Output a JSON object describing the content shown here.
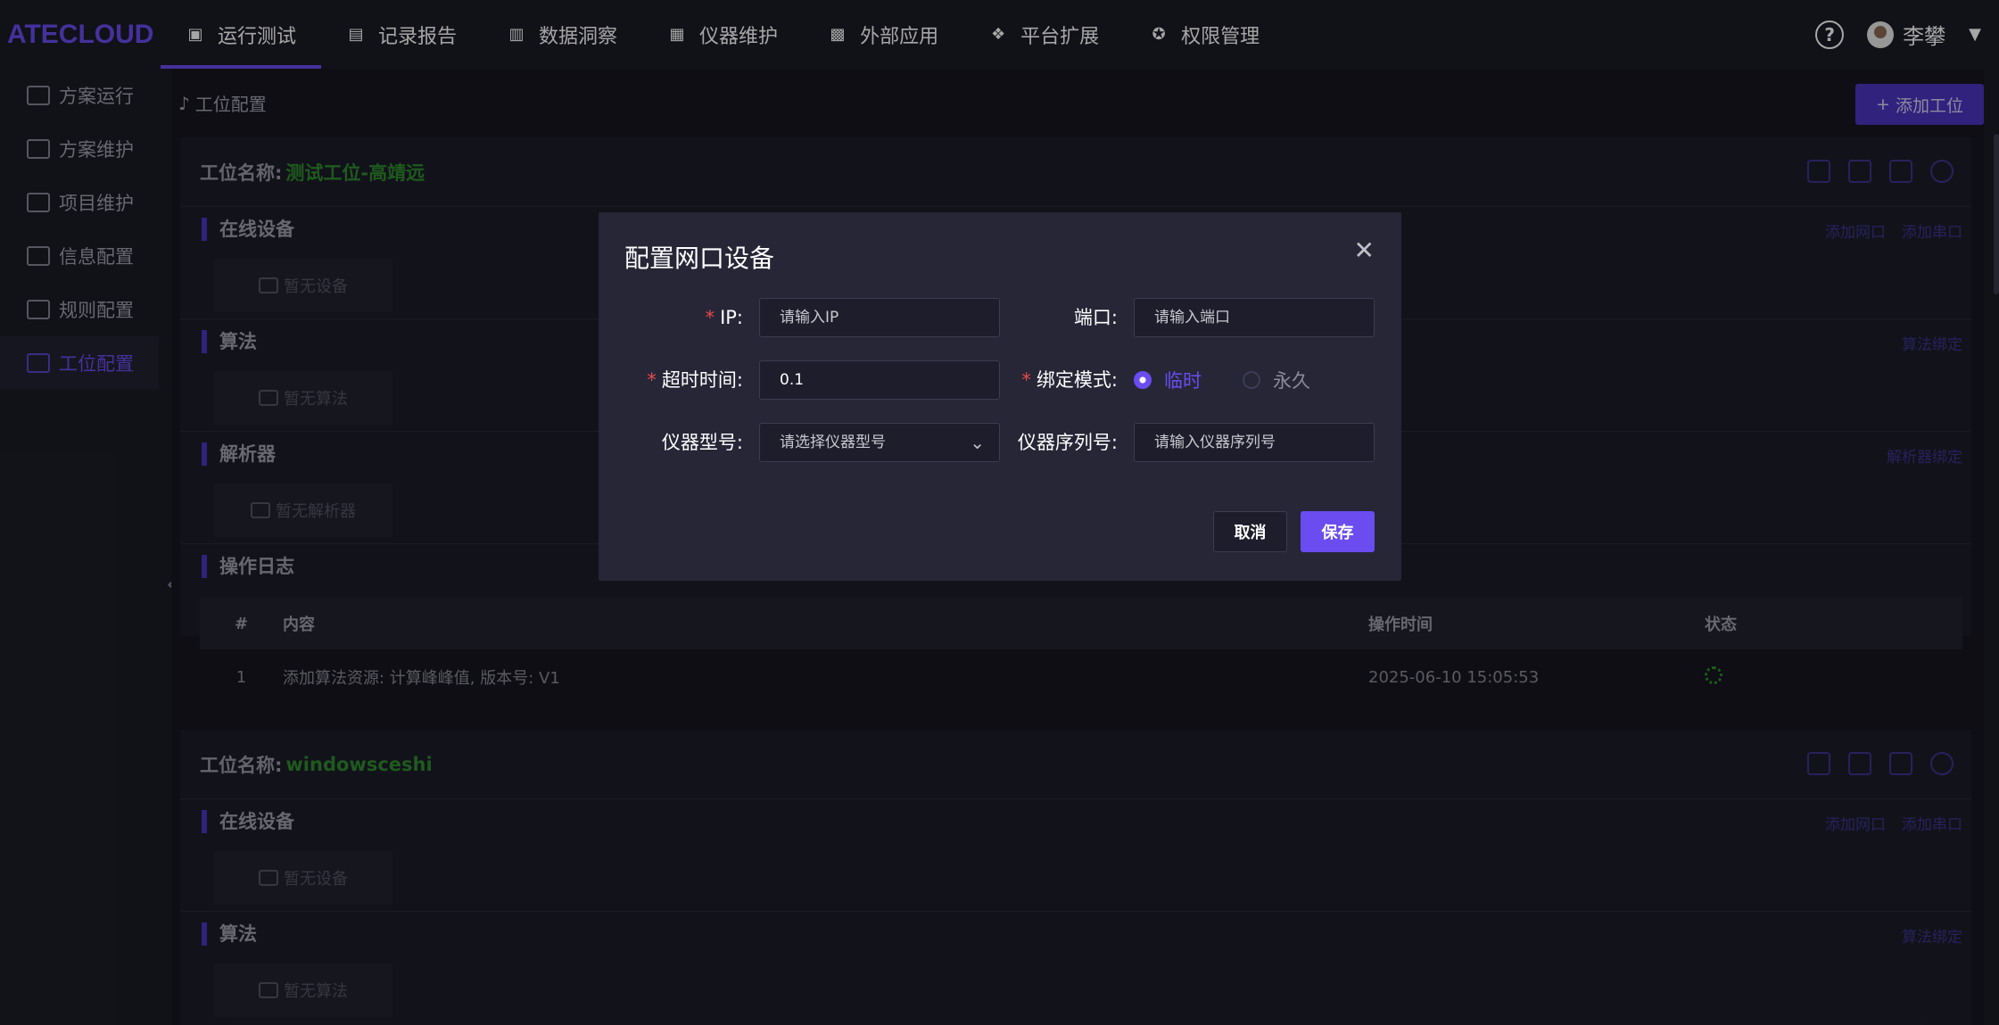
{
  "app": {
    "logo": "ATECLOUD"
  },
  "nav": [
    {
      "label": "运行测试",
      "icon": "chart-line-icon",
      "active": true
    },
    {
      "label": "记录报告",
      "icon": "clipboard-icon",
      "active": false
    },
    {
      "label": "数据洞察",
      "icon": "monitor-chart-icon",
      "active": false
    },
    {
      "label": "仪器维护",
      "icon": "instrument-icon",
      "active": false
    },
    {
      "label": "外部应用",
      "icon": "grid-apps-icon",
      "active": false
    },
    {
      "label": "平台扩展",
      "icon": "cubes-icon",
      "active": false
    },
    {
      "label": "权限管理",
      "icon": "users-icon",
      "active": false
    }
  ],
  "user": {
    "name": "李攀"
  },
  "sidebar": {
    "items": [
      {
        "label": "方案运行",
        "active": false
      },
      {
        "label": "方案维护",
        "active": false
      },
      {
        "label": "项目维护",
        "active": false
      },
      {
        "label": "信息配置",
        "active": false
      },
      {
        "label": "规则配置",
        "active": false
      },
      {
        "label": "工位配置",
        "active": true
      }
    ]
  },
  "breadcrumb": {
    "current": "工位配置"
  },
  "add_station_label": "添加工位",
  "stations": [
    {
      "name_label": "工位名称:",
      "name": "测试工位-高靖远",
      "sections": {
        "online_devices": {
          "title": "在线设备",
          "links": [
            "添加网口",
            "添加串口"
          ],
          "empty": "暂无设备"
        },
        "algorithm": {
          "title": "算法",
          "links": [
            "算法绑定"
          ],
          "empty": "暂无算法"
        },
        "parser": {
          "title": "解析器",
          "links": [
            "解析器绑定"
          ],
          "empty": "暂无解析器"
        },
        "log": {
          "title": "操作日志",
          "columns": [
            "#",
            "内容",
            "操作时间",
            "状态"
          ],
          "rows": [
            {
              "index": "1",
              "content": "添加算法资源: 计算峰峰值, 版本号: V1",
              "time": "2025-06-10 15:05:53"
            }
          ]
        }
      }
    },
    {
      "name_label": "工位名称:",
      "name": "windowsceshi",
      "sections": {
        "online_devices": {
          "title": "在线设备",
          "links": [
            "添加网口",
            "添加串口"
          ],
          "empty": "暂无设备"
        },
        "algorithm": {
          "title": "算法",
          "links": [
            "算法绑定"
          ],
          "empty": "暂无算法"
        }
      }
    }
  ],
  "dialog": {
    "title": "配置网口设备",
    "fields": {
      "ip": {
        "label": "IP:",
        "required": true,
        "placeholder": "请输入IP"
      },
      "port": {
        "label": "端口:",
        "required": false,
        "placeholder": "请输入端口"
      },
      "timeout": {
        "label": "超时时间:",
        "required": true,
        "value": "0.1"
      },
      "bind_mode": {
        "label": "绑定模式:",
        "required": true,
        "options": [
          "临时",
          "永久"
        ],
        "selected": "临时"
      },
      "model": {
        "label": "仪器型号:",
        "required": false,
        "placeholder": "请选择仪器型号"
      },
      "serial": {
        "label": "仪器序列号:",
        "required": false,
        "placeholder": "请输入仪器序列号"
      }
    },
    "cancel_label": "取消",
    "save_label": "保存"
  },
  "colors": {
    "accent": "#6a4cf0",
    "station_name": "#2f8a2f",
    "required": "#e84a4a"
  }
}
